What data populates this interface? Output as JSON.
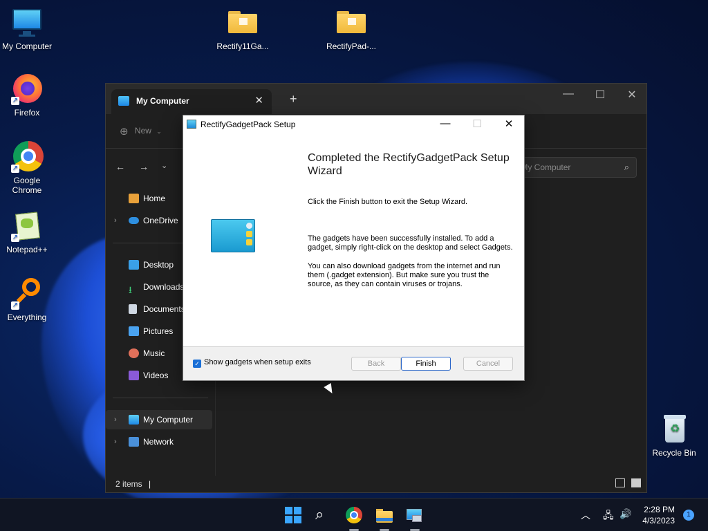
{
  "desktop": {
    "icons": [
      {
        "label": "My Computer",
        "icon": "monitor-icon"
      },
      {
        "label": "Firefox",
        "icon": "firefox-icon"
      },
      {
        "label": "Google Chrome",
        "icon": "chrome-icon"
      },
      {
        "label": "Notepad++",
        "icon": "notepadpp-icon"
      },
      {
        "label": "Everything",
        "icon": "everything-icon"
      },
      {
        "label": "Rectify11Ga...",
        "icon": "folder-icon"
      },
      {
        "label": "RectifyPad-...",
        "icon": "folder-icon"
      },
      {
        "label": "Recycle Bin",
        "icon": "recycle-bin-icon"
      }
    ]
  },
  "explorer": {
    "tab_title": "My Computer",
    "new_label": "New",
    "search_placeholder": "Search My Computer",
    "sidebar": [
      {
        "label": "Home",
        "icon": "home-icon"
      },
      {
        "label": "OneDrive",
        "icon": "cloud-icon"
      },
      {
        "label": "Desktop",
        "icon": "desktop-icon"
      },
      {
        "label": "Downloads",
        "icon": "download-icon"
      },
      {
        "label": "Documents",
        "icon": "document-icon"
      },
      {
        "label": "Pictures",
        "icon": "pictures-icon"
      },
      {
        "label": "Music",
        "icon": "music-icon"
      },
      {
        "label": "Videos",
        "icon": "videos-icon"
      },
      {
        "label": "My Computer",
        "icon": "monitor-icon"
      },
      {
        "label": "Network",
        "icon": "network-icon"
      }
    ],
    "status": "2 items"
  },
  "dialog": {
    "title": "RectifyGadgetPack Setup",
    "heading": "Completed the RectifyGadgetPack Setup Wizard",
    "p1": "Click the Finish button to exit the Setup Wizard.",
    "p2": "The gadgets have been successfully installed. To add a gadget, simply right-click on the desktop and select Gadgets.",
    "p3": "You can also download gadgets from the internet and run them (.gadget extension). But make sure you trust the source, as they can contain viruses or trojans.",
    "checkbox_label": "Show gadgets when setup exits",
    "checkbox_checked": true,
    "back_label": "Back",
    "finish_label": "Finish",
    "cancel_label": "Cancel"
  },
  "taskbar": {
    "time": "2:28 PM",
    "date": "4/3/2023",
    "notification_count": "1"
  }
}
